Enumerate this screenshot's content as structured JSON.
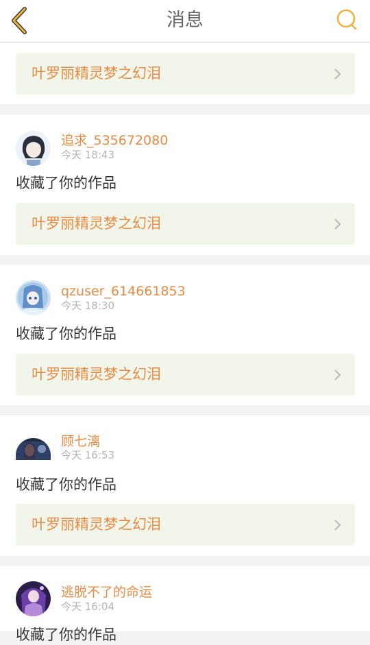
{
  "header": {
    "title": "消息"
  },
  "top_card": {
    "work_title": "叶罗丽精灵梦之幻泪"
  },
  "messages": [
    {
      "user": "追求_535672080",
      "time": "今天 18:43",
      "action": "收藏了你的作品",
      "work_title": "叶罗丽精灵梦之幻泪"
    },
    {
      "user": "qzuser_614661853",
      "time": "今天 18:30",
      "action": "收藏了你的作品",
      "work_title": "叶罗丽精灵梦之幻泪"
    },
    {
      "user": "顾七漓",
      "time": "今天 16:53",
      "action": "收藏了你的作品",
      "work_title": "叶罗丽精灵梦之幻泪"
    },
    {
      "user": "逃脱不了的命运",
      "time": "今天 16:04",
      "action": "收藏了你的作品"
    }
  ],
  "colors": {
    "accent": "#e98b43",
    "work_bg": "#f1f5ea",
    "icon": "#f0b23a"
  }
}
